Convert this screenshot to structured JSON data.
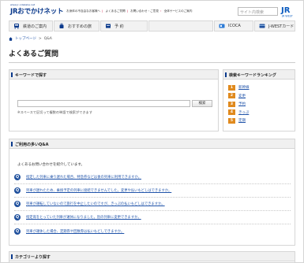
{
  "header": {
    "logo_small": "www.jr-odekake.net",
    "logo": "JRおでかけネット",
    "top_links": [
      "お身体の不自由なお客様へ",
      "よくあるご質問",
      "お問い合わせ・ご意見",
      "全体サービスのご案内"
    ],
    "search_placeholder": "サイト内検索",
    "brand": "JR WEST"
  },
  "nav": {
    "items": [
      {
        "label": "鉄道のご案内"
      },
      {
        "label": "おすすめの旅"
      },
      {
        "label": "予 約"
      },
      {
        "label": ""
      },
      {
        "label": "ICOCA"
      },
      {
        "label": "J-WESTカード"
      }
    ]
  },
  "breadcrumb": {
    "home": "トップページ",
    "sep": ">",
    "current": "Q&A"
  },
  "page": {
    "title": "よくあるご質問"
  },
  "keyword_search": {
    "heading": "キーワードで探す",
    "button": "検索",
    "note": "※スペースで区切って複数の単語で検索ができます"
  },
  "ranking": {
    "heading": "検索キーワードランキング",
    "items": [
      {
        "rank": "1",
        "word": "新幹線"
      },
      {
        "rank": "2",
        "word": "変更"
      },
      {
        "rank": "3",
        "word": "予約"
      },
      {
        "rank": "4",
        "word": "きっぷ"
      },
      {
        "rank": "5",
        "word": "定期"
      }
    ]
  },
  "qa": {
    "heading": "ご利用の多いQ&A",
    "lead": "よくあるお問い合わせを紹介しています。",
    "items": [
      {
        "mark": "Q",
        "text": "指定した列車に乗り遅れた場合、特急券などは後の列車に利用できますか。"
      },
      {
        "mark": "Q",
        "text": "列車が遅れたため、乗換予定の列車に接続できませんでした。変更や払いもどしはできますか。"
      },
      {
        "mark": "Q",
        "text": "列車が運転していないので旅行を中止したいのですが、きっぷの払いもどしはできますか。"
      },
      {
        "mark": "Q",
        "text": "指定席をとっていた列車が運休になりました。別の列車に変更できますか。"
      },
      {
        "mark": "Q",
        "text": "列車が運休した場合、定期券や回数券は払いもどしできますか。"
      }
    ]
  },
  "category": {
    "heading": "カテゴリーより探す"
  }
}
